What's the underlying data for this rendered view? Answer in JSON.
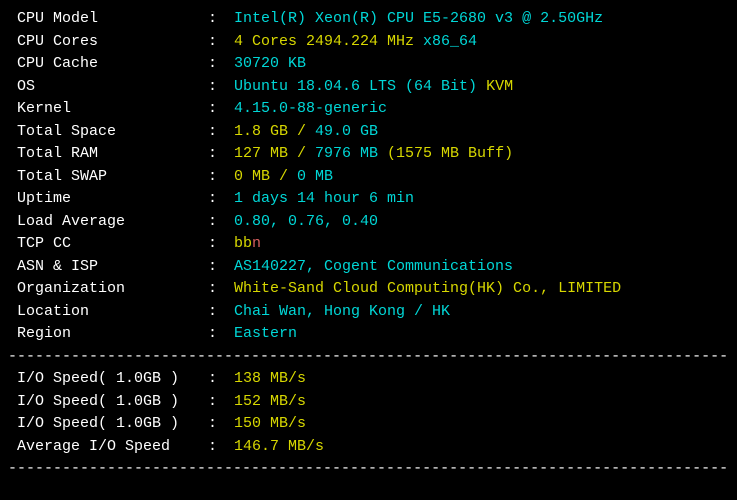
{
  "rows": [
    {
      "label": "CPU Model",
      "parts": [
        {
          "text": "Intel(R) Xeon(R) CPU E5-2680 v3 @ 2.50GHz",
          "color": "cyan"
        }
      ]
    },
    {
      "label": "CPU Cores",
      "parts": [
        {
          "text": "4 Cores 2494.224 MHz ",
          "color": "yellow"
        },
        {
          "text": "x86_64",
          "color": "cyan"
        }
      ]
    },
    {
      "label": "CPU Cache",
      "parts": [
        {
          "text": "30720 KB",
          "color": "cyan"
        }
      ]
    },
    {
      "label": "OS",
      "parts": [
        {
          "text": "Ubuntu 18.04.6 LTS (64 Bit) ",
          "color": "cyan"
        },
        {
          "text": "KVM",
          "color": "yellow"
        }
      ]
    },
    {
      "label": "Kernel",
      "parts": [
        {
          "text": "4.15.0-88-generic",
          "color": "cyan"
        }
      ]
    },
    {
      "label": "Total Space",
      "parts": [
        {
          "text": "1.8 GB / ",
          "color": "yellow"
        },
        {
          "text": "49.0 GB",
          "color": "cyan"
        }
      ]
    },
    {
      "label": "Total RAM",
      "parts": [
        {
          "text": "127 MB / ",
          "color": "yellow"
        },
        {
          "text": "7976 MB ",
          "color": "cyan"
        },
        {
          "text": "(1575 MB Buff)",
          "color": "yellow"
        }
      ]
    },
    {
      "label": "Total SWAP",
      "parts": [
        {
          "text": "0 MB / ",
          "color": "yellow"
        },
        {
          "text": "0 MB",
          "color": "cyan"
        }
      ]
    },
    {
      "label": "Uptime",
      "parts": [
        {
          "text": "1 days 14 hour 6 min",
          "color": "cyan"
        }
      ]
    },
    {
      "label": "Load Average",
      "parts": [
        {
          "text": "0.80, 0.76, 0.40",
          "color": "cyan"
        }
      ]
    },
    {
      "label": "TCP CC",
      "parts": [
        {
          "text": "bb",
          "color": "yellow"
        },
        {
          "text": "n",
          "color": "red"
        }
      ]
    },
    {
      "label": "ASN & ISP",
      "parts": [
        {
          "text": "AS140227, Cogent Communications",
          "color": "cyan"
        }
      ]
    },
    {
      "label": "Organization",
      "parts": [
        {
          "text": "White-Sand Cloud Computing(HK) Co., LIMITED",
          "color": "yellow"
        }
      ]
    },
    {
      "label": "Location",
      "parts": [
        {
          "text": "Chai Wan, Hong Kong / HK",
          "color": "cyan"
        }
      ]
    },
    {
      "label": "Region",
      "parts": [
        {
          "text": "Eastern",
          "color": "cyan"
        }
      ]
    }
  ],
  "io_rows": [
    {
      "label": "I/O Speed( 1.0GB )",
      "parts": [
        {
          "text": "138 MB/s",
          "color": "yellow"
        }
      ]
    },
    {
      "label": "I/O Speed( 1.0GB )",
      "parts": [
        {
          "text": "152 MB/s",
          "color": "yellow"
        }
      ]
    },
    {
      "label": "I/O Speed( 1.0GB )",
      "parts": [
        {
          "text": "150 MB/s",
          "color": "yellow"
        }
      ]
    },
    {
      "label": "Average I/O Speed",
      "parts": [
        {
          "text": "146.7 MB/s",
          "color": "yellow"
        }
      ]
    }
  ],
  "divider": "----------------------------------------------------------------------------------"
}
